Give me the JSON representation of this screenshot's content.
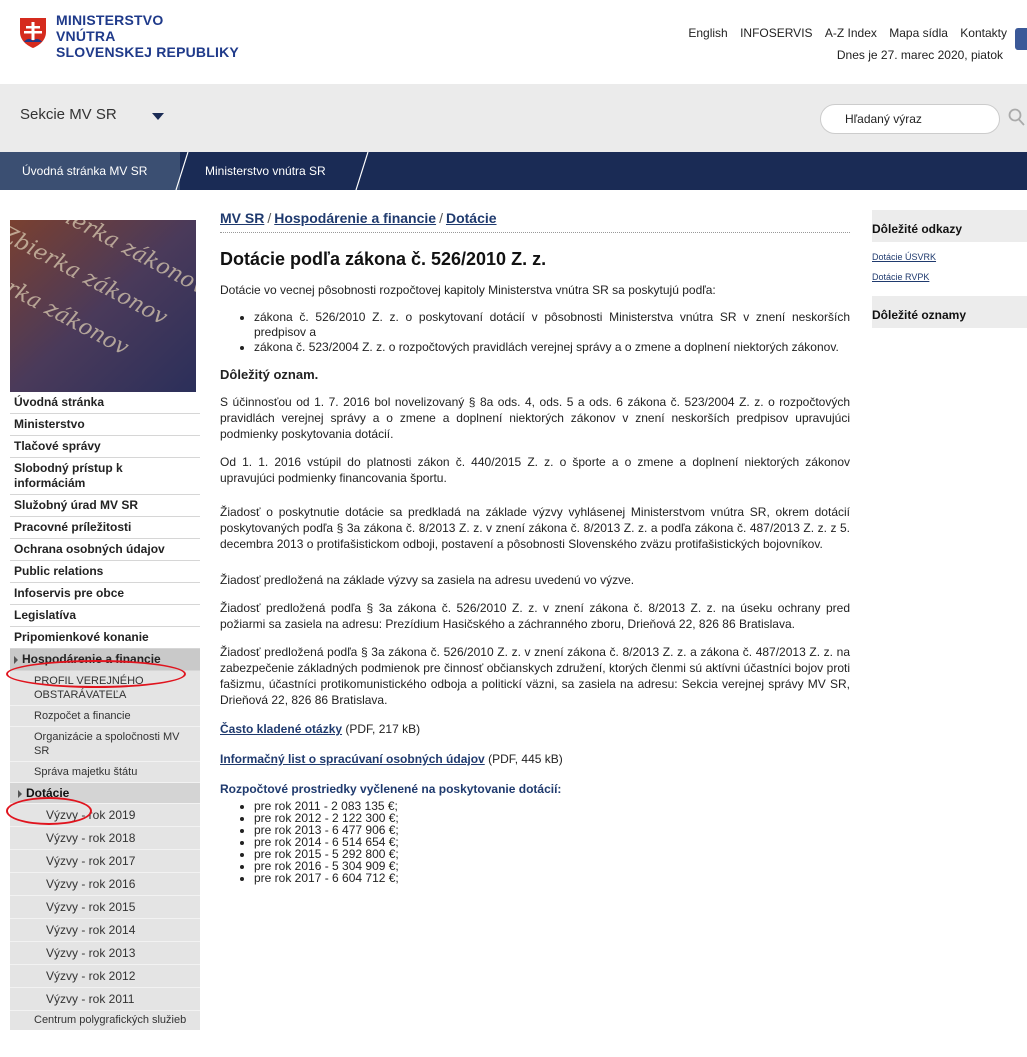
{
  "header": {
    "logo_lines": [
      "MINISTERSTVO",
      "VNÚTRA",
      "SLOVENSKEJ REPUBLIKY"
    ],
    "top_links": [
      "English",
      "INFOSERVIS",
      "A-Z Index",
      "Mapa sídla",
      "Kontakty"
    ],
    "date": "Dnes je 27. marec 2020, piatok"
  },
  "sections_bar": {
    "label": "Sekcie MV SR",
    "search_placeholder": "Hľadaný výraz"
  },
  "nav": {
    "items": [
      "Úvodná stránka MV SR",
      "Ministerstvo vnútra SR"
    ]
  },
  "book_image_text": "Zbierka zákonov",
  "sidebar": {
    "items": [
      "Úvodná stránka",
      "Ministerstvo",
      "Tlačové správy",
      "Slobodný prístup k informáciám",
      "Služobný úrad MV SR",
      "Pracovné príležitosti",
      "Ochrana osobných údajov",
      "Public relations",
      "Infoservis pre obce",
      "Legislatíva",
      "Pripomienkové konanie"
    ],
    "active": "Hospodárenie a financie",
    "subitems": [
      "PROFIL VEREJNÉHO OBSTARÁVATEĽA",
      "Rozpočet a financie",
      "Organizácie a spoločnosti MV SR",
      "Správa majetku štátu"
    ],
    "active_sub": "Dotácie",
    "subsubitems": [
      "Výzvy - rok 2019",
      "Výzvy - rok 2018",
      "Výzvy - rok 2017",
      "Výzvy - rok 2016",
      "Výzvy - rok 2015",
      "Výzvy - rok 2014",
      "Výzvy - rok 2013",
      "Výzvy - rok 2012",
      "Výzvy - rok 2011"
    ],
    "bottom_item": "Centrum polygrafických služieb"
  },
  "breadcrumb": {
    "items": [
      "MV SR",
      "Hospodárenie a financie",
      "Dotácie"
    ],
    "separator": "/"
  },
  "main": {
    "title": "Dotácie podľa zákona č. 526/2010 Z. z.",
    "intro": "Dotácie vo vecnej pôsobnosti rozpočtovej kapitoly Ministerstva vnútra SR sa poskytujú podľa:",
    "laws": [
      "zákona č. 526/2010 Z. z. o poskytovaní dotácií v pôsobnosti Ministerstva vnútra SR v znení neskorších predpisov a",
      "zákona č. 523/2004 Z. z. o rozpočtových pravidlách verejnej správy a o zmene a doplnení niektorých zákonov."
    ],
    "notice_title": "Dôležitý oznam.",
    "paragraphs": [
      "S účinnosťou od 1. 7. 2016 bol novelizovaný § 8a ods. 4, ods. 5 a ods. 6 zákona č. 523/2004 Z. z. o rozpočtových pravidlách verejnej správy a o zmene a doplnení niektorých zákonov v znení neskorších predpisov upravujúci podmienky poskytovania dotácií.",
      "Od 1. 1. 2016 vstúpil do platnosti zákon č. 440/2015 Z. z. o športe a o zmene a doplnení niektorých zákonov upravujúci podmienky financovania športu.",
      "Žiadosť o poskytnutie dotácie sa predkladá na základe výzvy vyhlásenej Ministerstvom vnútra SR, okrem dotácií poskytovaných podľa § 3a zákona č. 8/2013 Z. z. v znení zákona č. 8/2013 Z. z. a podľa zákona č. 487/2013 Z. z. z 5. decembra 2013 o protifašistickom odboji, postavení a pôsobnosti Slovenského zväzu protifašistických bojovníkov.",
      "Žiadosť predložená na základe výzvy sa zasiela na adresu uvedenú vo výzve.",
      "Žiadosť predložená podľa § 3a zákona č. 526/2010 Z. z. v znení zákona č. 8/2013 Z. z. na úseku ochrany pred požiarmi sa zasiela na adresu: Prezídium Hasičského a záchranného zboru, Drieňová 22, 826 86 Bratislava.",
      "Žiadosť predložená podľa § 3a zákona č. 526/2010 Z. z. v znení zákona č. 8/2013 Z. z. a zákona č. 487/2013 Z. z. na zabezpečenie základných podmienok pre činnosť občianskych združení, ktorých členmi sú aktívni účastníci bojov proti fašizmu, účastníci protikomunistického odboja a politickí väzni, sa zasiela na adresu: Sekcia verejnej správy MV SR, Drieňová 22, 826 86 Bratislava."
    ],
    "faq_link": "Často kladené otázky",
    "faq_meta": "(PDF, 217 kB)",
    "info_link": "Informačný list o spracúvaní osobných údajov",
    "info_meta": "(PDF, 445 kB)",
    "budget_title": "Rozpočtové prostriedky vyčlenené na poskytovanie dotácií:",
    "budget_items": [
      "pre rok 2011 -  2 083 135 €;",
      "pre rok 2012 -  2 122 300 €;",
      "pre rok 2013 -  6 477 906 €;",
      "pre rok 2014 -  6 514 654 €;",
      "pre rok 2015 -  5 292 800 €;",
      "pre rok 2016 -  5 304 909 €;",
      "pre rok 2017 -  6 604 712 €;"
    ]
  },
  "right": {
    "links_title": "Dôležité odkazy",
    "links": [
      "Dotácie ÚSVRK",
      "Dotácie RVPK"
    ],
    "notices_title": "Dôležité oznamy"
  },
  "colors": {
    "navy": "#1a2b55",
    "link": "#1f3a6e",
    "highlight_circle": "#e0141e",
    "sidebar_active": "#c9c9c9"
  }
}
